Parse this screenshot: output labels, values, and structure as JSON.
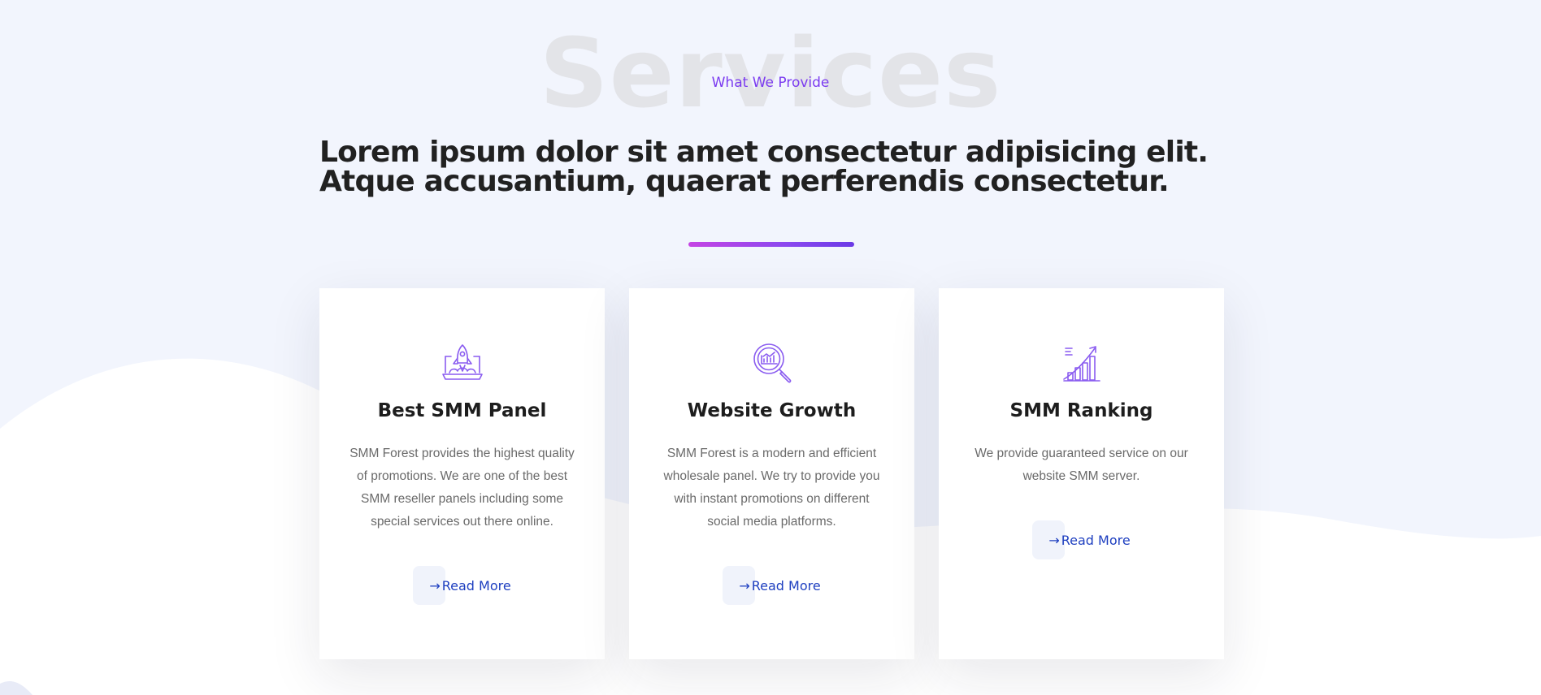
{
  "section": {
    "watermark": "Services",
    "eyebrow": "What We Provide",
    "headline_line1": "Lorem ipsum dolor sit amet consectetur adipisicing elit.",
    "headline_line2": "Atque accusantium, quaerat perferendis consectetur."
  },
  "colors": {
    "accent": "#7b3bf0",
    "gradient_start": "#c544e4",
    "gradient_end": "#6b3ae6",
    "link": "#1e3fc0",
    "background": "#f2f5fd"
  },
  "cards": [
    {
      "icon": "rocket-launch-icon",
      "title": "Best SMM Panel",
      "text": "SMM Forest provides the highest quality of promotions. We are one of the best SMM reseller panels including some special services out there online.",
      "read_more_arrow": "→",
      "read_more_label": "Read More"
    },
    {
      "icon": "magnifier-chart-icon",
      "title": "Website Growth",
      "text": "SMM Forest is a modern and efficient wholesale panel. We try to provide you with instant promotions on different social media platforms.",
      "read_more_arrow": "→",
      "read_more_label": "Read More"
    },
    {
      "icon": "growth-chart-icon",
      "title": "SMM Ranking",
      "text": "We provide guaranteed service on our website SMM server.",
      "read_more_arrow": "→",
      "read_more_label": "Read More"
    }
  ]
}
